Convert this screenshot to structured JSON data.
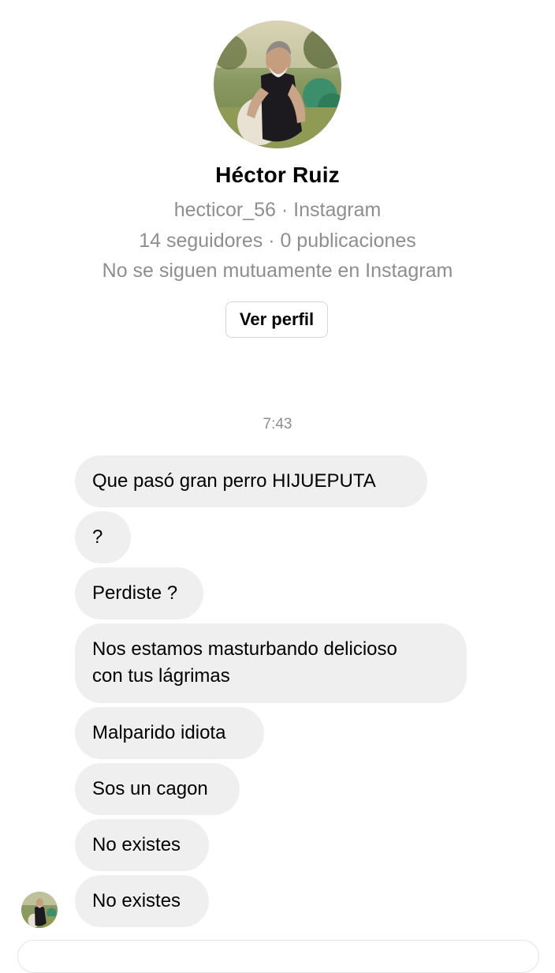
{
  "profile": {
    "name": "Héctor Ruiz",
    "handle_line": "hecticor_56 · Instagram",
    "stats_line": "14 seguidores · 0 publicaciones",
    "mutual_line": "No se siguen mutuamente en Instagram",
    "view_profile_label": "Ver perfil"
  },
  "conversation": {
    "timestamp": "7:43",
    "messages": [
      "Que pasó gran perro HIJUEPUTA",
      "?",
      "Perdiste ?",
      "Nos estamos masturbando delicioso\ncon tus lágrimas",
      "Malparido idiota",
      "Sos un cagon",
      "No existes",
      "No existes"
    ]
  },
  "colors": {
    "bubble_bg": "#efefef",
    "secondary_text": "#8e8e8e",
    "button_border": "#d6d6d6"
  }
}
